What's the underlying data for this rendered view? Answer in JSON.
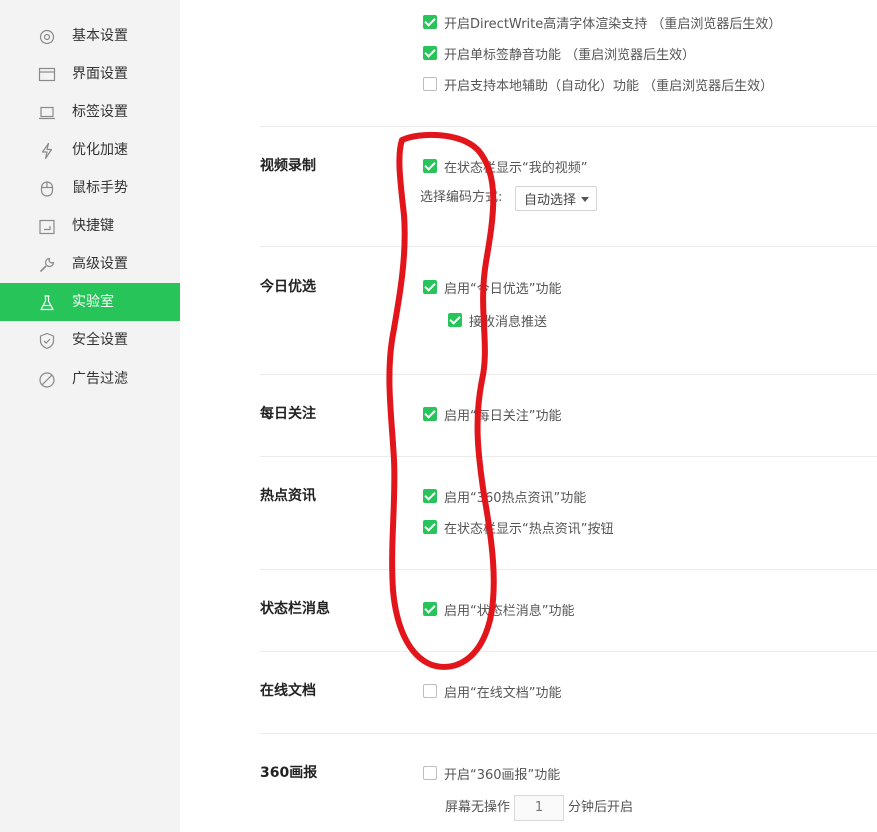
{
  "sidebar": {
    "items": [
      {
        "label": "基本设置",
        "icon": "gear-icon"
      },
      {
        "label": "界面设置",
        "icon": "window-icon"
      },
      {
        "label": "标签设置",
        "icon": "tab-icon"
      },
      {
        "label": "优化加速",
        "icon": "lightning-icon"
      },
      {
        "label": "鼠标手势",
        "icon": "mouse-icon"
      },
      {
        "label": "快捷键",
        "icon": "keyboard-icon"
      },
      {
        "label": "高级设置",
        "icon": "wrench-icon"
      },
      {
        "label": "实验室",
        "icon": "flask-icon",
        "active": true
      },
      {
        "label": "安全设置",
        "icon": "shield-icon"
      },
      {
        "label": "广告过滤",
        "icon": "block-icon"
      }
    ]
  },
  "top_options": [
    {
      "label": "开启DirectWrite高清字体渲染支持  （重启浏览器后生效）",
      "checked": true
    },
    {
      "label": "开启单标签静音功能  （重启浏览器后生效）",
      "checked": true
    },
    {
      "label": "开启支持本地辅助（自动化）功能  （重启浏览器后生效）",
      "checked": false
    }
  ],
  "sections": {
    "video": {
      "title": "视频录制",
      "option": {
        "label": "在状态栏显示“我的视频”",
        "checked": true
      },
      "encode_label": "选择编码方式:",
      "encode_value": "自动选择"
    },
    "today": {
      "title": "今日优选",
      "option": {
        "label": "启用“今日优选”功能",
        "checked": true
      },
      "sub_option": {
        "label": "接收消息推送",
        "checked": true
      }
    },
    "daily": {
      "title": "每日关注",
      "option": {
        "label": "启用“每日关注”功能",
        "checked": true
      }
    },
    "hot": {
      "title": "热点资讯",
      "options": [
        {
          "label": "启用“360热点资讯”功能",
          "checked": true
        },
        {
          "label": "在状态栏显示“热点资讯”按钮",
          "checked": true
        }
      ]
    },
    "status": {
      "title": "状态栏消息",
      "option": {
        "label": "启用“状态栏消息”功能",
        "checked": true
      }
    },
    "docs": {
      "title": "在线文档",
      "option": {
        "label": "启用“在线文档”功能",
        "checked": false
      }
    },
    "pictorial": {
      "title": "360画报",
      "option": {
        "label": "开启“360画报”功能",
        "checked": false
      },
      "idle_prefix": "屏幕无操作",
      "idle_value": "1",
      "idle_suffix": "分钟后开启"
    }
  },
  "colors": {
    "accent": "#27c45a",
    "annotation": "#e2151b"
  }
}
